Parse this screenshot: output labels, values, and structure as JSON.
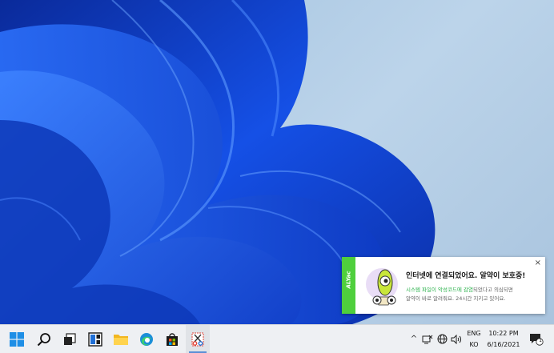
{
  "toast": {
    "app_name": "ALYac",
    "title": "인터넷에 연결되었어요. 알약이 보호중!",
    "line1_highlight": "시스템 파일이 악성코드에 감염",
    "line1_rest": "되었다고 의심되면",
    "line2": "알약이 바로 알려줘요. 24시간 지키고 있어요.",
    "close_label": "×",
    "accent_color": "#4fcf3d"
  },
  "taskbar": {
    "apps": [
      {
        "name": "start",
        "icon": "windows-logo-icon"
      },
      {
        "name": "search",
        "icon": "search-icon"
      },
      {
        "name": "task-view",
        "icon": "task-view-icon"
      },
      {
        "name": "widgets",
        "icon": "widgets-icon"
      },
      {
        "name": "file-explorer",
        "icon": "folder-icon"
      },
      {
        "name": "edge",
        "icon": "edge-icon"
      },
      {
        "name": "store",
        "icon": "store-icon"
      },
      {
        "name": "snipping-tool",
        "icon": "scissors-icon",
        "active": true
      }
    ],
    "tray": {
      "chevron": "^",
      "lang_top": "ENG",
      "lang_bottom": "KO",
      "time": "10:22 PM",
      "date": "6/16/2021",
      "notification_count": "1"
    }
  }
}
